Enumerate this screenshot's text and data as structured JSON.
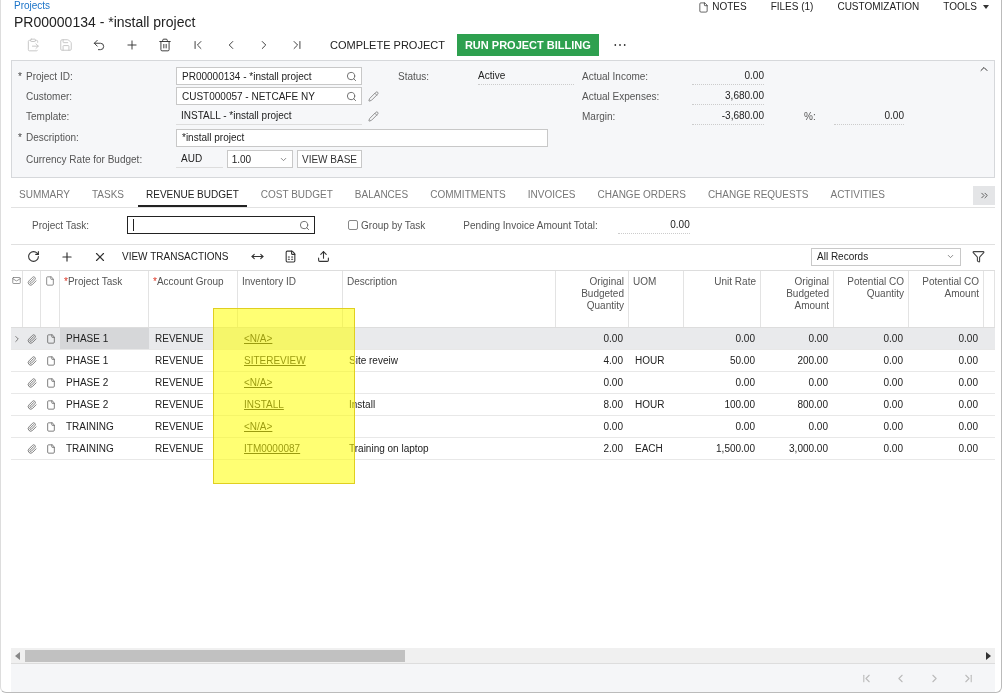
{
  "breadcrumb": "Projects",
  "title": "PR00000134 - *install project",
  "header_links": [
    {
      "label": "NOTES",
      "kind": "notes"
    },
    {
      "label": "FILES (1)",
      "kind": "plain"
    },
    {
      "label": "CUSTOMIZATION",
      "kind": "plain"
    },
    {
      "label": "TOOLS",
      "kind": "menu"
    }
  ],
  "toolbar_icons": [
    {
      "kind": "paste",
      "disabled": true
    },
    {
      "kind": "save",
      "disabled": true
    },
    {
      "kind": "undo",
      "disabled": false
    },
    {
      "kind": "add",
      "disabled": false
    },
    {
      "kind": "delete",
      "disabled": false
    },
    {
      "kind": "first",
      "disabled": false
    },
    {
      "kind": "prev",
      "disabled": false
    },
    {
      "kind": "next",
      "disabled": false
    },
    {
      "kind": "last",
      "disabled": false
    }
  ],
  "toolbar_buttons": [
    {
      "label": "COMPLETE PROJECT",
      "primary": false
    },
    {
      "label": "RUN PROJECT BILLING",
      "primary": true
    }
  ],
  "more": "⋯",
  "form": {
    "project_id": {
      "label": "Project ID:",
      "mark": "*",
      "value": "PR00000134 - *install project"
    },
    "customer": {
      "label": "Customer:",
      "value": "CUST000057 - NETCAFE NY"
    },
    "template": {
      "label": "Template:",
      "value": "INSTALL - *install project"
    },
    "description": {
      "label": "Description:",
      "mark": "*",
      "value": "*install project"
    },
    "currency": {
      "label": "Currency Rate for Budget:",
      "currency": "AUD",
      "rate": "1.00",
      "button": "VIEW BASE"
    },
    "status": {
      "label": "Status:",
      "value": "Active"
    },
    "actual_income": {
      "label": "Actual Income:",
      "value": "0.00"
    },
    "actual_expenses": {
      "label": "Actual Expenses:",
      "value": "3,680.00"
    },
    "margin": {
      "label": "Margin:",
      "value": "-3,680.00"
    },
    "margin_pct": {
      "label": "%:",
      "value": "0.00"
    }
  },
  "tabs": [
    {
      "label": "SUMMARY",
      "selected": false
    },
    {
      "label": "TASKS",
      "selected": false
    },
    {
      "label": "REVENUE BUDGET",
      "selected": true
    },
    {
      "label": "COST BUDGET",
      "selected": false
    },
    {
      "label": "BALANCES",
      "selected": false
    },
    {
      "label": "COMMITMENTS",
      "selected": false
    },
    {
      "label": "INVOICES",
      "selected": false
    },
    {
      "label": "CHANGE ORDERS",
      "selected": false
    },
    {
      "label": "CHANGE REQUESTS",
      "selected": false
    },
    {
      "label": "ACTIVITIES",
      "selected": false
    }
  ],
  "filter": {
    "task_label": "Project Task:",
    "group_label": "Group by Task",
    "group_checked": false,
    "pending_label": "Pending Invoice Amount Total:",
    "pending_value": "0.00"
  },
  "grid_toolbar": {
    "button": "VIEW TRANSACTIONS",
    "records": "All Records"
  },
  "columns": [
    {
      "label": "Project Task",
      "mark": "*",
      "kind": "text"
    },
    {
      "label": "Account Group",
      "mark": "*",
      "kind": "text"
    },
    {
      "label": "Inventory ID",
      "kind": "link"
    },
    {
      "label": "Description",
      "kind": "text"
    },
    {
      "label": "Original Budgeted Quantity",
      "kind": "number"
    },
    {
      "label": "UOM",
      "kind": "text"
    },
    {
      "label": "Unit Rate",
      "kind": "number"
    },
    {
      "label": "Original Budgeted Amount",
      "kind": "number"
    },
    {
      "label": "Potential CO Quantity",
      "kind": "number"
    },
    {
      "label": "Potential CO Amount",
      "kind": "number"
    }
  ],
  "rows": [
    {
      "selected": true,
      "cells": [
        "PHASE 1",
        "REVENUE",
        "<N/A>",
        "",
        "0.00",
        "",
        "0.00",
        "0.00",
        "0.00",
        "0.00"
      ]
    },
    {
      "selected": false,
      "cells": [
        "PHASE 1",
        "REVENUE",
        "SITEREVIEW",
        "Site reveiw",
        "4.00",
        "HOUR",
        "50.00",
        "200.00",
        "0.00",
        "0.00"
      ]
    },
    {
      "selected": false,
      "cells": [
        "PHASE 2",
        "REVENUE",
        "<N/A>",
        "",
        "0.00",
        "",
        "0.00",
        "0.00",
        "0.00",
        "0.00"
      ]
    },
    {
      "selected": false,
      "cells": [
        "PHASE 2",
        "REVENUE",
        "INSTALL",
        "Install",
        "8.00",
        "HOUR",
        "100.00",
        "800.00",
        "0.00",
        "0.00"
      ]
    },
    {
      "selected": false,
      "cells": [
        "TRAINING",
        "REVENUE",
        "<N/A>",
        "",
        "0.00",
        "",
        "0.00",
        "0.00",
        "0.00",
        "0.00"
      ]
    },
    {
      "selected": false,
      "cells": [
        "TRAINING",
        "REVENUE",
        "ITM0000087",
        "Training on laptop",
        "2.00",
        "EACH",
        "1,500.00",
        "3,000.00",
        "0.00",
        "0.00"
      ]
    }
  ]
}
